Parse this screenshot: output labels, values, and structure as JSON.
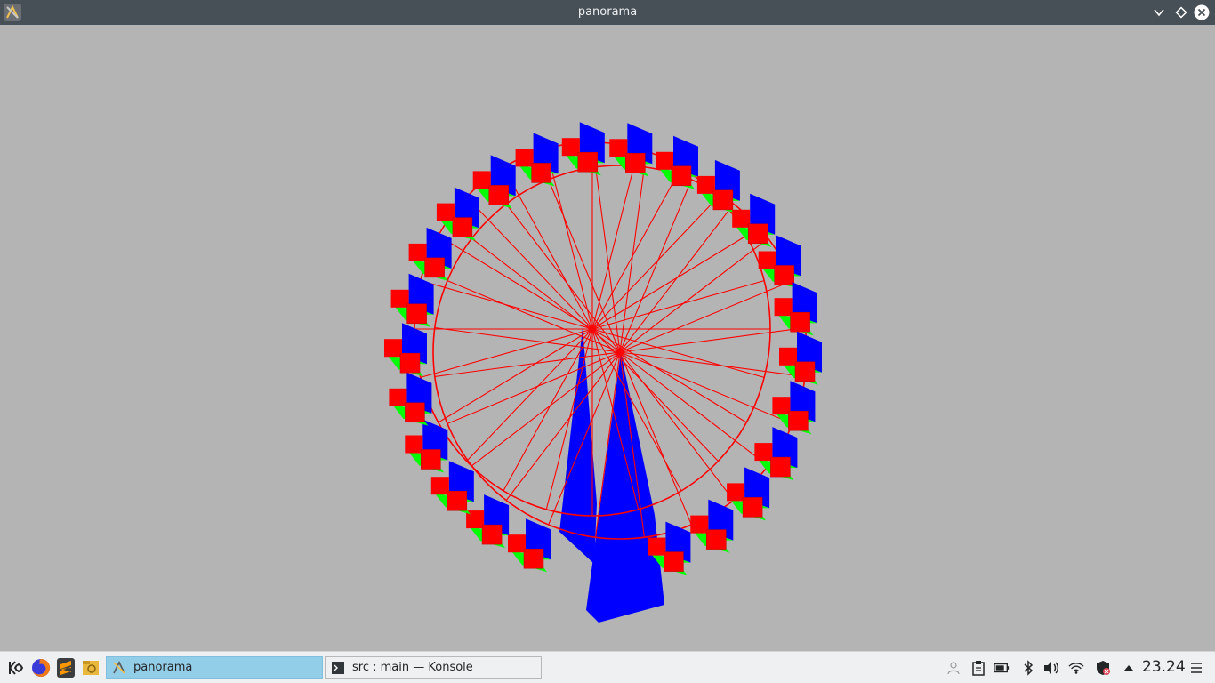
{
  "window": {
    "title": "panorama",
    "app_icon": "kde-app-icon",
    "controls": [
      "minimize-icon",
      "keep-above-icon",
      "close-icon"
    ]
  },
  "scene": {
    "description_icon": "ferris-wheel-3d-render",
    "colors": {
      "background": "#b4b4b4",
      "rim": "#ff0000",
      "support": "#0000ff",
      "cabin_back": "#0000ff",
      "cabin_floor": "#00ff00",
      "cabin_seat": "#ff0000"
    }
  },
  "taskbar": {
    "launchers": [
      "kde-menu-icon",
      "firefox-icon",
      "sublime-text-icon",
      "file-manager-icon"
    ],
    "tasks": [
      {
        "label": "panorama",
        "icon": "kde-app-icon",
        "active": true
      },
      {
        "label": "src : main — Konsole",
        "icon": "terminal-icon",
        "active": false
      }
    ],
    "tray": [
      "user-switch-icon",
      "clipboard-icon",
      "battery-icon",
      "bluetooth-icon",
      "volume-icon",
      "wifi-icon",
      "security-icon",
      "tray-expand-icon"
    ],
    "clock": "23.24",
    "menu_icon": "hamburger-menu-icon"
  }
}
